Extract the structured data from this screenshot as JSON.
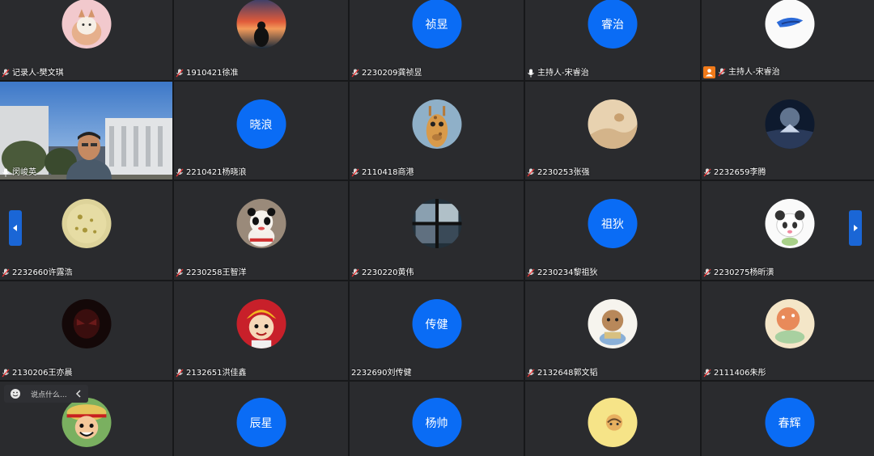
{
  "tiles": [
    {
      "label": "记录人-樊文琪",
      "avatar_text": ""
    },
    {
      "label": "1910421徐准",
      "avatar_text": ""
    },
    {
      "label": "2230209龚祯昱",
      "avatar_text": "祯昱"
    },
    {
      "label": "主持人-宋睿治",
      "avatar_text": "睿治"
    },
    {
      "label": "主持人-宋睿治",
      "avatar_text": ""
    },
    {
      "label": "闵峻英",
      "avatar_text": ""
    },
    {
      "label": "2210421杨晓浪",
      "avatar_text": "晓浪"
    },
    {
      "label": "2110418商港",
      "avatar_text": ""
    },
    {
      "label": "2230253张强",
      "avatar_text": ""
    },
    {
      "label": "2232659李腾",
      "avatar_text": ""
    },
    {
      "label": "2232660许露浩",
      "avatar_text": ""
    },
    {
      "label": "2230258王智洋",
      "avatar_text": ""
    },
    {
      "label": "2230220黄伟",
      "avatar_text": ""
    },
    {
      "label": "2230234黎祖狄",
      "avatar_text": "祖狄"
    },
    {
      "label": "2230275杨昕潢",
      "avatar_text": ""
    },
    {
      "label": "2130206王亦晨",
      "avatar_text": ""
    },
    {
      "label": "2132651洪佳鑫",
      "avatar_text": ""
    },
    {
      "label": "2232690刘传健",
      "avatar_text": "传健"
    },
    {
      "label": "2132648郭文韬",
      "avatar_text": ""
    },
    {
      "label": "2111406朱彤",
      "avatar_text": ""
    },
    {
      "label": "",
      "avatar_text": ""
    },
    {
      "label": "",
      "avatar_text": "辰星"
    },
    {
      "label": "",
      "avatar_text": "杨帅"
    },
    {
      "label": "",
      "avatar_text": ""
    },
    {
      "label": "",
      "avatar_text": "春辉"
    }
  ],
  "chat": {
    "placeholder": "说点什么..."
  },
  "colors": {
    "accent": "#0a6cf5",
    "host_badge": "#f07a1a",
    "tile_bg": "#2a2b2e"
  }
}
